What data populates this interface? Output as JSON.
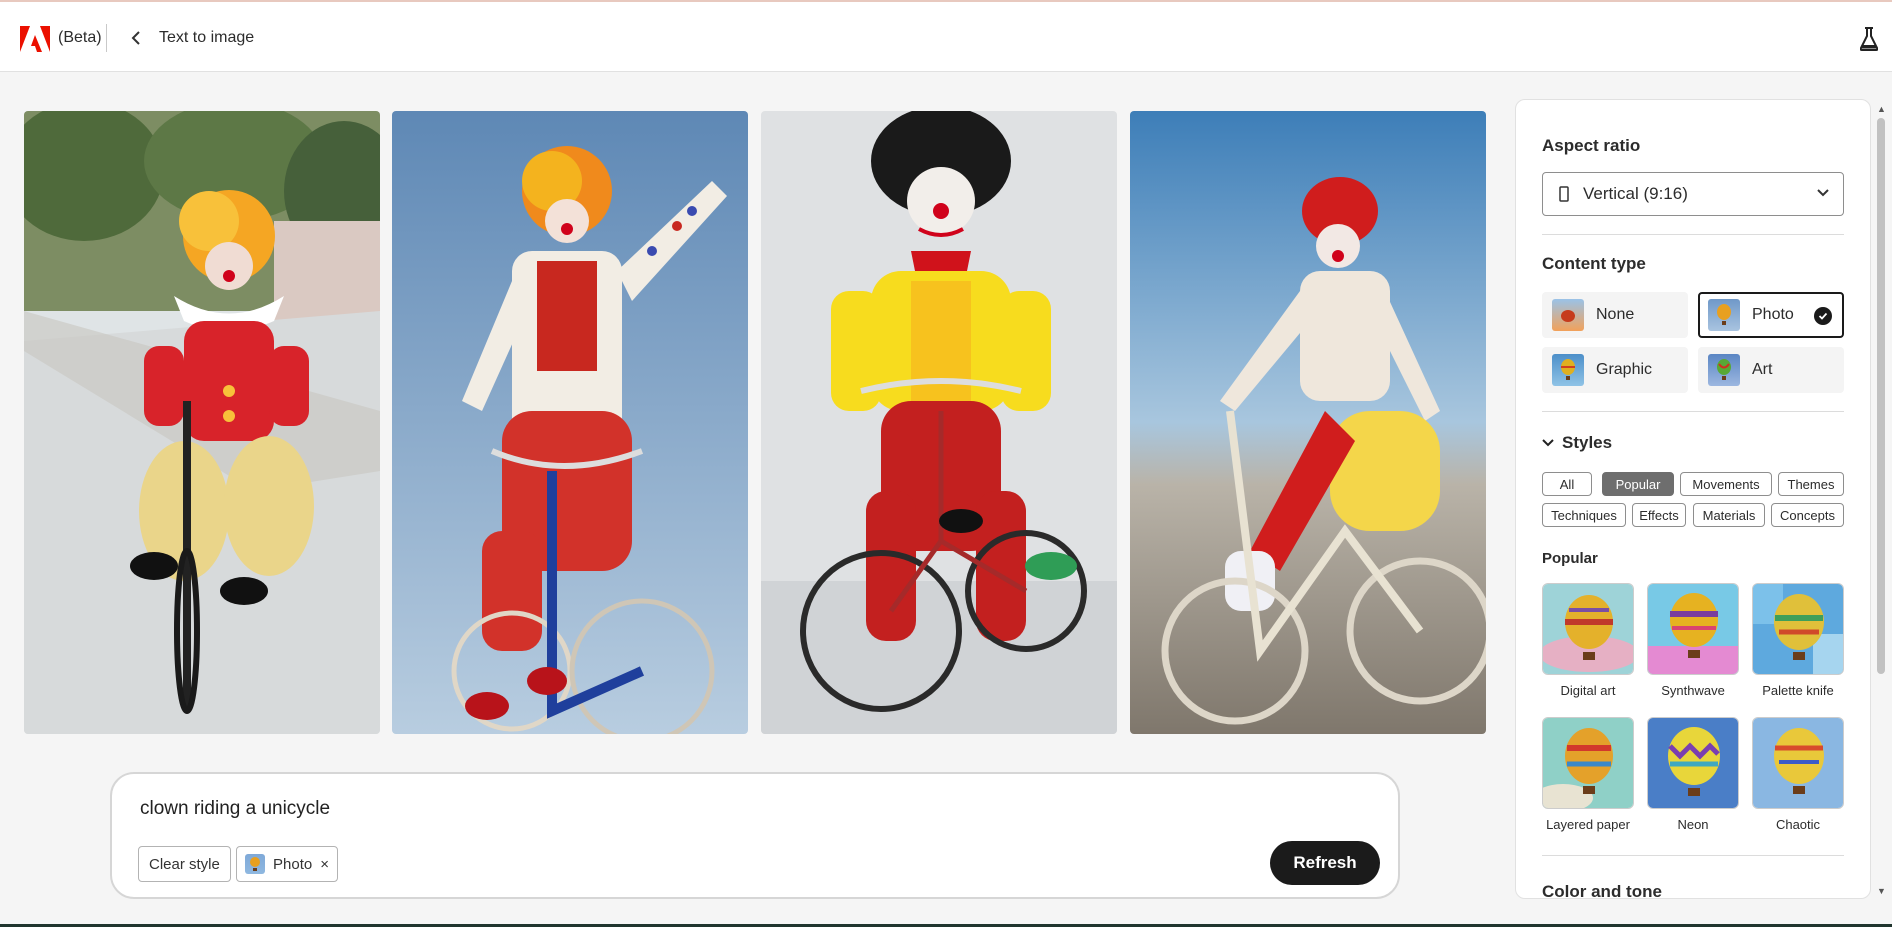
{
  "header": {
    "beta_label": "(Beta)",
    "breadcrumb": "Text to image"
  },
  "gallery": {
    "images": [
      {
        "alt": "clown on unicycle track"
      },
      {
        "alt": "clown on blue bicycle"
      },
      {
        "alt": "clown on red bicycle"
      },
      {
        "alt": "clown on white bicycle"
      }
    ]
  },
  "prompt": {
    "text": "clown riding a unicycle",
    "clear_style_label": "Clear style",
    "chip_label": "Photo",
    "chip_close": "×",
    "refresh_label": "Refresh"
  },
  "panel": {
    "aspect_title": "Aspect ratio",
    "aspect_value": "Vertical (9:16)",
    "content_title": "Content type",
    "content_types": [
      {
        "label": "None",
        "selected": false
      },
      {
        "label": "Photo",
        "selected": true
      },
      {
        "label": "Graphic",
        "selected": false
      },
      {
        "label": "Art",
        "selected": false
      }
    ],
    "styles_title": "Styles",
    "style_filters": [
      {
        "label": "All",
        "active": false
      },
      {
        "label": "Popular",
        "active": true
      },
      {
        "label": "Movements",
        "active": false
      },
      {
        "label": "Themes",
        "active": false
      },
      {
        "label": "Techniques",
        "active": false
      },
      {
        "label": "Effects",
        "active": false
      },
      {
        "label": "Materials",
        "active": false
      },
      {
        "label": "Concepts",
        "active": false
      }
    ],
    "popular_title": "Popular",
    "popular_styles": [
      {
        "label": "Digital art"
      },
      {
        "label": "Synthwave"
      },
      {
        "label": "Palette knife"
      },
      {
        "label": "Layered paper"
      },
      {
        "label": "Neon"
      },
      {
        "label": "Chaotic"
      }
    ],
    "color_tone_title": "Color and tone"
  },
  "colors": {
    "accent_dark": "#1b1b1b",
    "adobe_red": "#eb1000"
  }
}
